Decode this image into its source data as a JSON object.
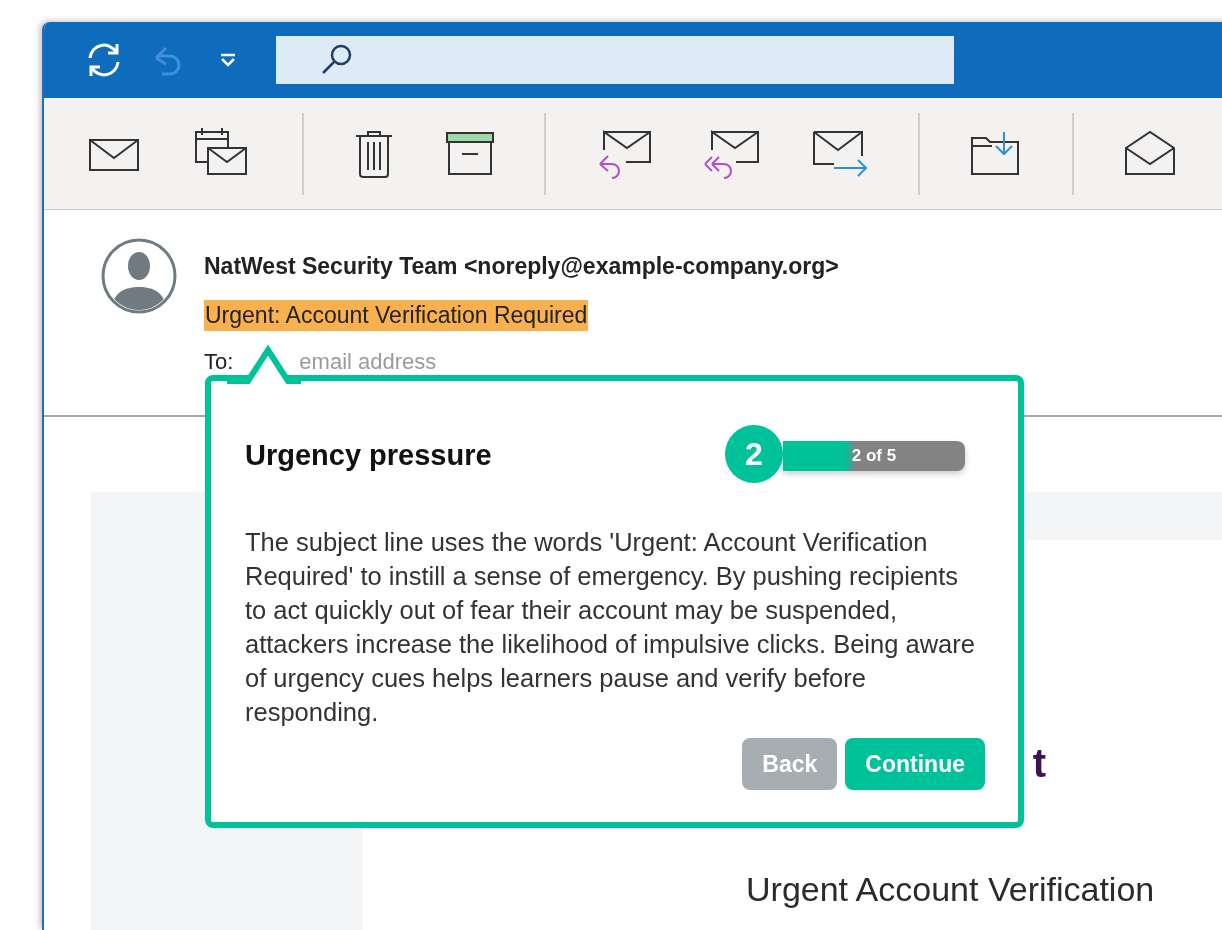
{
  "quick_access": [
    {
      "kind": "sync",
      "disabled": false
    },
    {
      "kind": "undo",
      "disabled": true
    },
    {
      "kind": "dropdown",
      "disabled": false
    }
  ],
  "toolbar": [
    {
      "kind": "new-mail"
    },
    {
      "kind": "new-meeting"
    },
    {
      "kind": "separator"
    },
    {
      "kind": "delete"
    },
    {
      "kind": "archive"
    },
    {
      "kind": "separator"
    },
    {
      "kind": "reply"
    },
    {
      "kind": "reply-all"
    },
    {
      "kind": "forward"
    },
    {
      "kind": "separator"
    },
    {
      "kind": "move"
    },
    {
      "kind": "separator"
    },
    {
      "kind": "read"
    }
  ],
  "message": {
    "sender": "NatWest Security Team <noreply@example-company.org>",
    "subject": "Urgent: Account Verification Required",
    "subject_highlighted": true,
    "to_label": "To:",
    "to_value": "email address"
  },
  "body": {
    "heading_fragment": "t",
    "title": "Urgent Account Verification"
  },
  "callout": {
    "title": "Urgency pressure",
    "step": "2",
    "progress_text": "2 of 5",
    "level": 0.4,
    "text": "The subject line uses the words 'Urgent: Account Verification Required' to instill a sense of emergency. By pushing recipients to act quickly out of fear their account may be suspended, attackers increase the likelihood of impulsive clicks. Being aware of urgency cues helps learners pause and verify before responding.",
    "buttons": [
      {
        "label": "Back",
        "kind": "secondary"
      },
      {
        "label": "Continue",
        "kind": "primary"
      }
    ]
  }
}
